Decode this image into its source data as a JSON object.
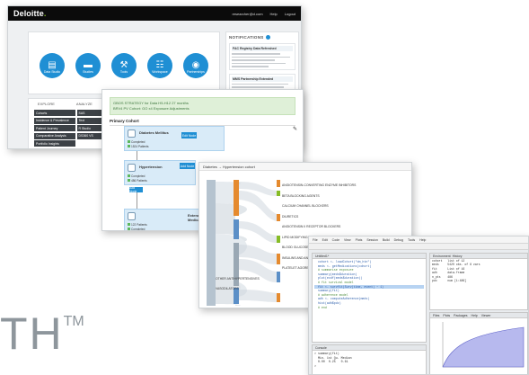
{
  "dashboard": {
    "logo": "Deloitte",
    "logo_dot": ".",
    "top_links": [
      "researcher@d.com",
      "Help",
      "Logout"
    ],
    "tiles": [
      {
        "label": "Data Studio",
        "icon": "database-icon"
      },
      {
        "label": "Studies",
        "icon": "folder-icon"
      },
      {
        "label": "Tools",
        "icon": "wrench-icon"
      },
      {
        "label": "Workspace",
        "icon": "grid-icon"
      },
      {
        "label": "Partnerships",
        "icon": "globe-icon"
      }
    ],
    "notifications": {
      "title": "NOTIFICATIONS",
      "cards": [
        {
          "heading": "FAC Registry Data Refreshed"
        },
        {
          "heading": "MMS Partnership Extended"
        }
      ]
    },
    "explore_tabs": [
      "EXPLORE",
      "ANALYZE"
    ],
    "menu": [
      [
        "Cohorts",
        "SAS"
      ],
      [
        "Incidence & Prevalence",
        "Text"
      ],
      [
        "Patient Journey",
        "R Studio"
      ],
      [
        "Comparative Analysis",
        "DS360 VS"
      ],
      [
        "Portfolio Insights",
        ""
      ]
    ]
  },
  "pipeline": {
    "banner_line1": "GBOS STRATEGY for Data H5-H12 27 months",
    "banner_line2": "BRV4 PV Cohort: GO x4 Exposure Adjustments",
    "section": "Primary Cohort",
    "nodes": [
      {
        "title": "Diabetes Mellitus",
        "status1": "Completed",
        "status2": "1524 Patients",
        "action": "Edit Node"
      },
      {
        "title": "Hypertension",
        "status1": "Completed",
        "status2": "486 Patients",
        "action": "Add Node"
      },
      {
        "title": "Extended Risk Medications",
        "status1": "122 Patients",
        "status2": "Completed",
        "action": "Add Node"
      }
    ]
  },
  "sankey": {
    "header": "Diabetes → Hypertension cohort",
    "labels": [
      "ANGIOTENSIN-CONVERTING ENZYME INHIBITORS",
      "BETA BLOCKING AGENTS",
      "CALCIUM CHANNEL BLOCKERS",
      "DIURETICS",
      "ANGIOTENSIN II RECEPTOR BLOCKERS",
      "LIPID MODIFYING AGENTS, PLAIN",
      "BLOOD GLUCOSE LOWERING DRUGS",
      "INSULINS AND ANALOGUES",
      "PLATELET AGGREGATION INHIBITORS",
      "OTHER ANTIHYPERTENSIVES",
      "VASODILATORS",
      "ANTITHROMBOTIC AGENTS"
    ]
  },
  "ide": {
    "menu": [
      "File",
      "Edit",
      "Code",
      "View",
      "Plots",
      "Session",
      "Build",
      "Debug",
      "Tools",
      "Help"
    ],
    "source_tab": "Untitled1*",
    "env_tab": "Environment",
    "history_tab": "History",
    "console_tab": "Console",
    "plots_tabs": [
      "Files",
      "Plots",
      "Packages",
      "Help",
      "Viewer"
    ],
    "code_lines": [
      "  cohort <- loadCohort(\"dm_htn\")",
      "  meds <- getMedications(cohort)",
      "  # summarise exposure",
      "  summary(meds$duration)",
      "  plot(ecdf(meds$duration))",
      "  # fit survival model",
      "  fit <- survfit(Surv(time, event) ~ 1)",
      "  summary(fit)",
      "  # adherence model",
      "  adh <- computeAdherence(meds)",
      "  hist(adh$pdc)",
      "  # end"
    ],
    "env_rows": [
      "cohort   list of 12",
      "meds     5420 obs. of 8 vars",
      "fit      List of 16",
      "adh      data.frame",
      "n_pts    486",
      "pdc      num [1:486]"
    ],
    "console_lines": [
      "> summary(fit)",
      "  Min. 1st Qu. Median",
      "  0.00  0.25   0.61",
      "> "
    ]
  },
  "trademark": {
    "text": "TH",
    "symbol": "TM"
  },
  "colors": {
    "accent": "#1f8fd4",
    "brand_green": "#86bc25",
    "success": "#3c763d"
  }
}
